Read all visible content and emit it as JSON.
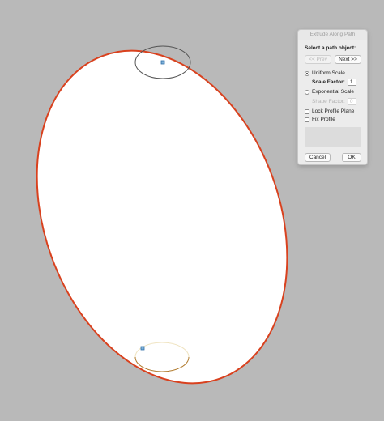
{
  "dialog": {
    "title": "Extrude Along Path",
    "prompt": "Select a path object:",
    "prev_label": "<< Prev",
    "next_label": "Next >>",
    "uniform_scale_label": "Uniform Scale",
    "uniform_scale_selected": true,
    "scale_factor_label": "Scale Factor:",
    "scale_factor_value": "1",
    "exponential_scale_label": "Exponential Scale",
    "exponential_scale_selected": false,
    "shape_factor_label": "Shape Factor:",
    "shape_factor_value": "0",
    "lock_profile_plane_label": "Lock Profile Plane",
    "lock_profile_plane_checked": false,
    "fix_profile_label": "Fix Profile",
    "fix_profile_checked": false,
    "cancel_label": "Cancel",
    "ok_label": "OK"
  },
  "canvas": {
    "background_color": "#b9b9b9",
    "path_color": "#d9411e",
    "profile_color": "#555555",
    "lower_ring_color": "#b07a2c",
    "handle_color": "#2f6fa8"
  }
}
